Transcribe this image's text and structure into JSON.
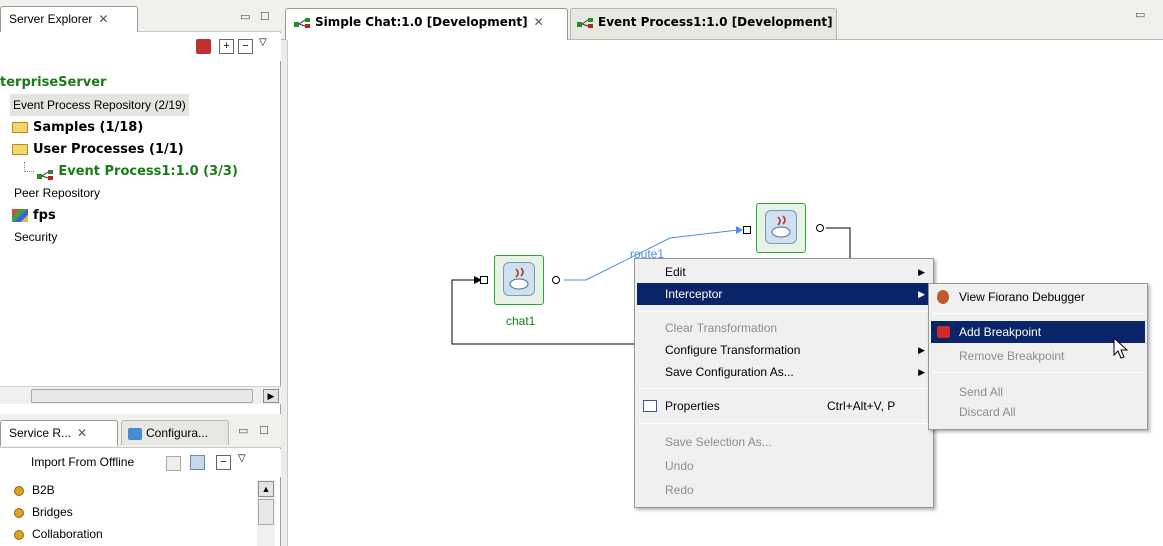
{
  "left_top_panel": {
    "tab_label": "Server Explorer",
    "tree": {
      "root": "terpriseServer",
      "event_repo": "Event Process Repository (2/19)",
      "samples": "Samples (1/18)",
      "user_processes": "User Processes (1/1)",
      "event_process": "Event Process1:1.0 (3/3)",
      "peer_repo": "Peer Repository",
      "fps": "fps",
      "security": "Security"
    }
  },
  "left_bottom_panel": {
    "tab1_label": "Service R...",
    "tab2_label": "Configura...",
    "import_label": "Import From Offline",
    "items": [
      "B2B",
      "Bridges",
      "Collaboration"
    ]
  },
  "editor": {
    "tab1_label": "Simple Chat:1.0 [Development]",
    "tab2_label": "Event Process1:1.0 [Development]"
  },
  "canvas": {
    "component1_label": "chat1",
    "route_label": "route1"
  },
  "context_menu": {
    "items": [
      {
        "label": "Edit"
      },
      {
        "label": "Interceptor"
      },
      {
        "label": "Clear Transformation"
      },
      {
        "label": "Configure Transformation"
      },
      {
        "label": "Save Configuration As..."
      },
      {
        "label": "Properties",
        "shortcut": "Ctrl+Alt+V, P"
      },
      {
        "label": "Save Selection As..."
      },
      {
        "label": "Undo"
      },
      {
        "label": "Redo"
      }
    ]
  },
  "submenu": {
    "items": [
      {
        "label": "View Fiorano Debugger"
      },
      {
        "label": "Add Breakpoint"
      },
      {
        "label": "Remove Breakpoint"
      },
      {
        "label": "Send All"
      },
      {
        "label": "Discard All"
      }
    ]
  },
  "colors": {
    "highlight": "#0a246a",
    "green_text": "#1a7a1a",
    "route_line": "#4a90e0"
  }
}
